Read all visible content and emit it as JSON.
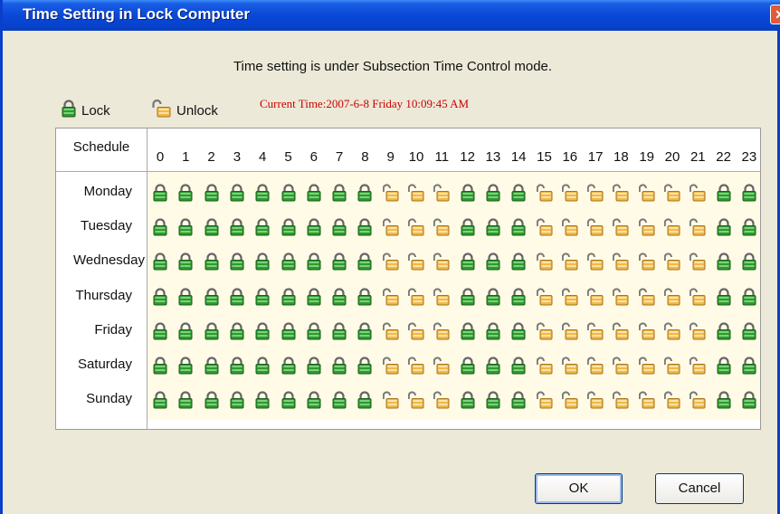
{
  "window": {
    "title": "Time Setting in Lock Computer",
    "close_symbol": "✕"
  },
  "mode_text": "Time setting is under Subsection Time Control mode.",
  "legend": {
    "lock_label": "Lock",
    "unlock_label": "Unlock"
  },
  "current_time": "Current Time:2007-6-8 Friday 10:09:45 AM",
  "grid": {
    "schedule_header": "Schedule",
    "hours": [
      "0",
      "1",
      "2",
      "3",
      "4",
      "5",
      "6",
      "7",
      "8",
      "9",
      "10",
      "11",
      "12",
      "13",
      "14",
      "15",
      "16",
      "17",
      "18",
      "19",
      "20",
      "21",
      "22",
      "23"
    ],
    "rows": [
      {
        "day": "Monday",
        "states": [
          "lock",
          "lock",
          "lock",
          "lock",
          "lock",
          "lock",
          "lock",
          "lock",
          "lock",
          "unlock",
          "unlock",
          "unlock",
          "lock",
          "lock",
          "lock",
          "unlock",
          "unlock",
          "unlock",
          "unlock",
          "unlock",
          "unlock",
          "unlock",
          "lock",
          "lock"
        ]
      },
      {
        "day": "Tuesday",
        "states": [
          "lock",
          "lock",
          "lock",
          "lock",
          "lock",
          "lock",
          "lock",
          "lock",
          "lock",
          "unlock",
          "unlock",
          "unlock",
          "lock",
          "lock",
          "lock",
          "unlock",
          "unlock",
          "unlock",
          "unlock",
          "unlock",
          "unlock",
          "unlock",
          "lock",
          "lock"
        ]
      },
      {
        "day": "Wednesday",
        "states": [
          "lock",
          "lock",
          "lock",
          "lock",
          "lock",
          "lock",
          "lock",
          "lock",
          "lock",
          "unlock",
          "unlock",
          "unlock",
          "lock",
          "lock",
          "lock",
          "unlock",
          "unlock",
          "unlock",
          "unlock",
          "unlock",
          "unlock",
          "unlock",
          "lock",
          "lock"
        ]
      },
      {
        "day": "Thursday",
        "states": [
          "lock",
          "lock",
          "lock",
          "lock",
          "lock",
          "lock",
          "lock",
          "lock",
          "lock",
          "unlock",
          "unlock",
          "unlock",
          "lock",
          "lock",
          "lock",
          "unlock",
          "unlock",
          "unlock",
          "unlock",
          "unlock",
          "unlock",
          "unlock",
          "lock",
          "lock"
        ]
      },
      {
        "day": "Friday",
        "states": [
          "lock",
          "lock",
          "lock",
          "lock",
          "lock",
          "lock",
          "lock",
          "lock",
          "lock",
          "unlock",
          "unlock",
          "unlock",
          "lock",
          "lock",
          "lock",
          "unlock",
          "unlock",
          "unlock",
          "unlock",
          "unlock",
          "unlock",
          "unlock",
          "lock",
          "lock"
        ]
      },
      {
        "day": "Saturday",
        "states": [
          "lock",
          "lock",
          "lock",
          "lock",
          "lock",
          "lock",
          "lock",
          "lock",
          "lock",
          "unlock",
          "unlock",
          "unlock",
          "lock",
          "lock",
          "lock",
          "unlock",
          "unlock",
          "unlock",
          "unlock",
          "unlock",
          "unlock",
          "unlock",
          "lock",
          "lock"
        ]
      },
      {
        "day": "Sunday",
        "states": [
          "lock",
          "lock",
          "lock",
          "lock",
          "lock",
          "lock",
          "lock",
          "lock",
          "lock",
          "unlock",
          "unlock",
          "unlock",
          "lock",
          "lock",
          "lock",
          "unlock",
          "unlock",
          "unlock",
          "unlock",
          "unlock",
          "unlock",
          "unlock",
          "lock",
          "lock"
        ]
      }
    ]
  },
  "buttons": {
    "ok_label": "OK",
    "cancel_label": "Cancel"
  },
  "colors": {
    "title_bar": "#0a48d8",
    "dialog_bg": "#ece9d8",
    "lock_icon": "#2e9a2e",
    "unlock_icon": "#e2a93a",
    "current_time_text": "#cc0000",
    "grid_body_bg": "#fffbe6"
  }
}
